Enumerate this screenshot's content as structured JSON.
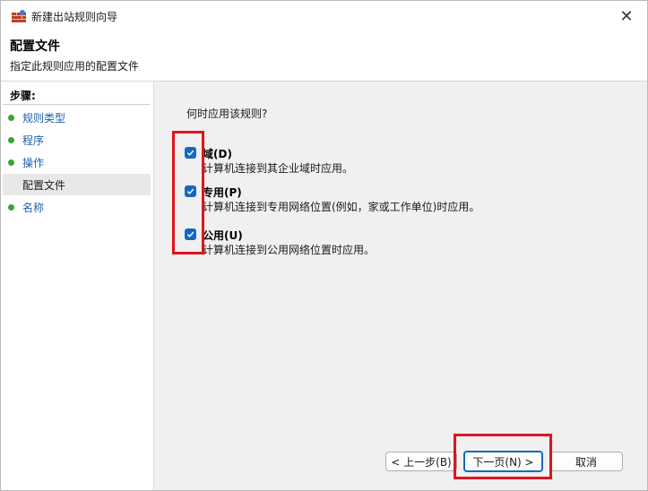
{
  "window": {
    "title": "新建出站规则向导",
    "close_glyph": "✕"
  },
  "header": {
    "title": "配置文件",
    "subtitle": "指定此规则应用的配置文件"
  },
  "sidebar": {
    "title": "步骤:",
    "items": [
      {
        "label": "规则类型"
      },
      {
        "label": "程序"
      },
      {
        "label": "操作"
      },
      {
        "label": "配置文件"
      },
      {
        "label": "名称"
      }
    ]
  },
  "main": {
    "question": "何时应用该规则?",
    "options": [
      {
        "label": "域(D)",
        "description": "计算机连接到其企业域时应用。",
        "checked": true
      },
      {
        "label": "专用(P)",
        "description": "计算机连接到专用网络位置(例如，家或工作单位)时应用。",
        "checked": true
      },
      {
        "label": "公用(U)",
        "description": "计算机连接到公用网络位置时应用。",
        "checked": true
      }
    ]
  },
  "footer": {
    "back_label": "< 上一步(B)",
    "next_label": "下一页(N) >",
    "cancel_label": "取消"
  },
  "colors": {
    "checkbox": "#1667c1",
    "highlight_box": "#e0141d",
    "step_dot": "#3aa336",
    "step_link": "#1f5fb4"
  }
}
